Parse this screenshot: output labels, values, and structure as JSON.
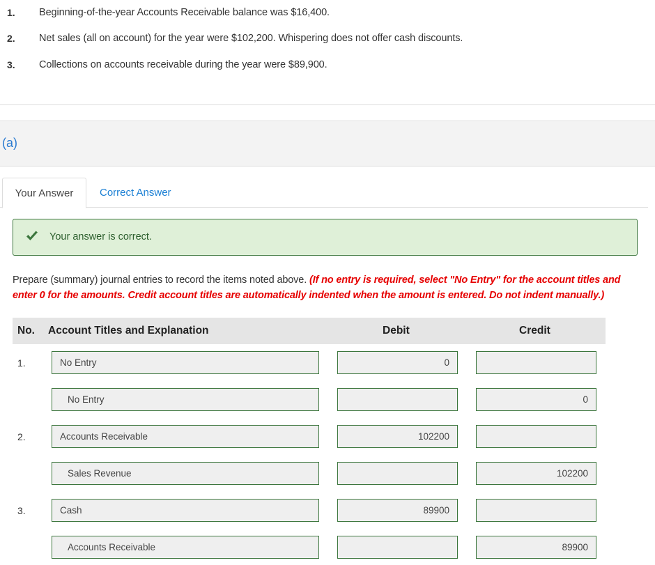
{
  "given": [
    {
      "num": "1.",
      "text": "Beginning-of-the-year Accounts Receivable balance was $16,400."
    },
    {
      "num": "2.",
      "text": "Net sales (all on account) for the year were $102,200. Whispering does not offer cash discounts."
    },
    {
      "num": "3.",
      "text": "Collections on accounts receivable during the year were $89,900."
    }
  ],
  "part": {
    "label": "(a)"
  },
  "tabs": [
    {
      "label": "Your Answer",
      "active": true
    },
    {
      "label": "Correct Answer",
      "active": false
    }
  ],
  "feedback": {
    "icon": "check-icon",
    "text": "Your answer is correct.",
    "color": "#3c763d",
    "background": "#dff0d8"
  },
  "instructions": {
    "text": "Prepare (summary) journal entries to record the items noted above. ",
    "note": "(If no entry is required, select \"No Entry\" for the account titles and enter 0 for the amounts. Credit account titles are automatically indented when the amount is entered. Do not indent manually.)"
  },
  "table": {
    "headers": {
      "no": "No.",
      "account": "Account Titles and Explanation",
      "debit": "Debit",
      "credit": "Credit"
    },
    "rows": [
      {
        "no": "1.",
        "account": "No Entry",
        "debit": "0",
        "credit": "",
        "indent": false
      },
      {
        "no": "",
        "account": "No Entry",
        "debit": "",
        "credit": "0",
        "indent": true
      },
      {
        "no": "2.",
        "account": "Accounts Receivable",
        "debit": "102200",
        "credit": "",
        "indent": false
      },
      {
        "no": "",
        "account": "Sales Revenue",
        "debit": "",
        "credit": "102200",
        "indent": true
      },
      {
        "no": "3.",
        "account": "Cash",
        "debit": "89900",
        "credit": "",
        "indent": false
      },
      {
        "no": "",
        "account": "Accounts Receivable",
        "debit": "",
        "credit": "89900",
        "indent": true
      }
    ]
  }
}
